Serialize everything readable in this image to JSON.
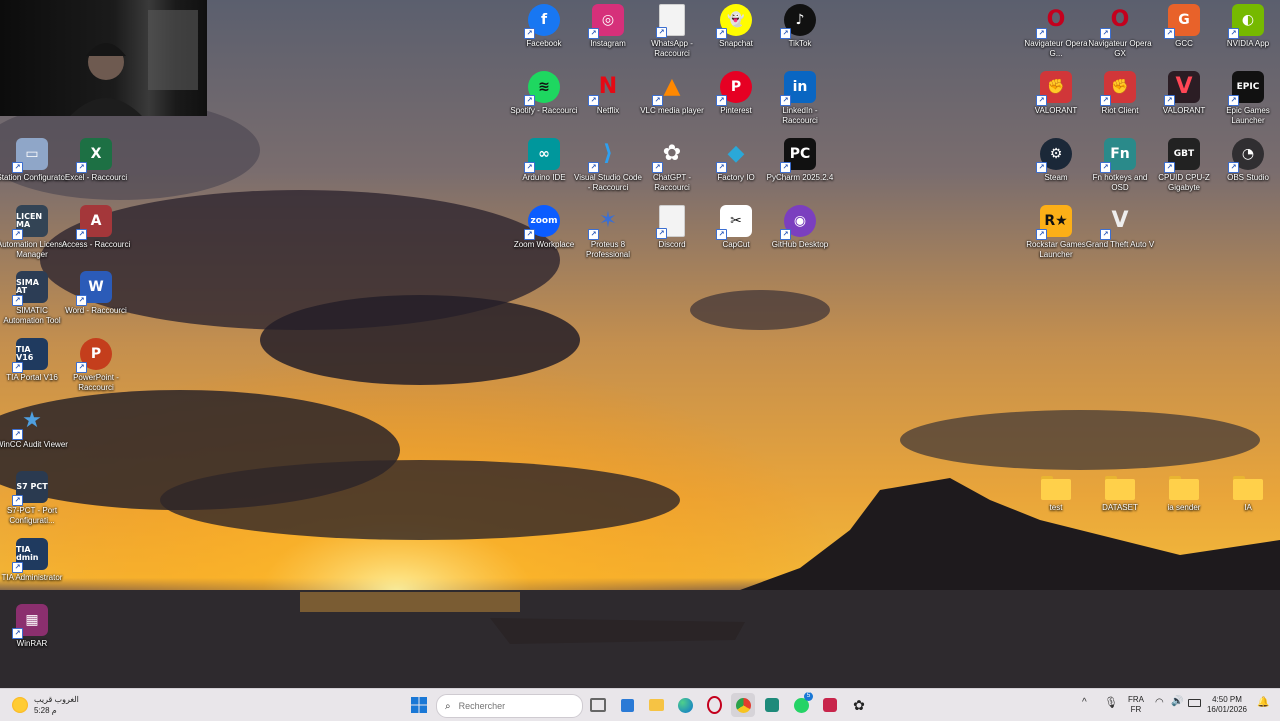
{
  "webcam": {
    "description_icon": "webcam-preview"
  },
  "desktop_icons": [
    {
      "id": "facebook",
      "label": "Facebook",
      "bg": "#1877f2",
      "glyph": "f",
      "round": true
    },
    {
      "id": "instagram",
      "label": "Instagram",
      "bg": "#d6307a",
      "glyph": "◎",
      "round": false
    },
    {
      "id": "whatsapp",
      "label": "WhatsApp - Raccourci",
      "bg": "#f3f3f3",
      "glyph": "",
      "round": false,
      "doc": true
    },
    {
      "id": "snapchat",
      "label": "Snapchat",
      "bg": "#fffc00",
      "glyph": "👻",
      "round": true,
      "dark": true
    },
    {
      "id": "tiktok",
      "label": "TikTok",
      "bg": "#111111",
      "glyph": "♪",
      "round": true
    },
    {
      "id": "spotify",
      "label": "Spotify - Raccourci",
      "bg": "#1ed760",
      "glyph": "≋",
      "round": true,
      "dark": true
    },
    {
      "id": "netflix",
      "label": "Netflix",
      "bg": "transparent",
      "glyph": "N",
      "round": false,
      "fg": "#e50914"
    },
    {
      "id": "vlc",
      "label": "VLC media player",
      "bg": "transparent",
      "glyph": "▲",
      "round": false,
      "fg": "#ff8800"
    },
    {
      "id": "pinterest",
      "label": "Pinterest",
      "bg": "#e60023",
      "glyph": "P",
      "round": true
    },
    {
      "id": "linkedin",
      "label": "LinkedIn - Raccourci",
      "bg": "#0a66c2",
      "glyph": "in",
      "round": false
    },
    {
      "id": "arduino",
      "label": "Arduino IDE",
      "bg": "#00979c",
      "glyph": "∞",
      "round": false
    },
    {
      "id": "vscode",
      "label": "Visual Studio Code - Raccourci",
      "bg": "transparent",
      "glyph": "⟩",
      "round": false,
      "fg": "#2ea0f0"
    },
    {
      "id": "chatgpt",
      "label": "ChatGPT - Raccourci",
      "bg": "transparent",
      "glyph": "✿",
      "round": false,
      "fg": "#ffffff"
    },
    {
      "id": "factoryio",
      "label": "Factory IO",
      "bg": "transparent",
      "glyph": "◆",
      "round": false,
      "fg": "#2aa8d8"
    },
    {
      "id": "pycharm",
      "label": "PyCharm 2025.2.4",
      "bg": "#111111",
      "glyph": "PC",
      "round": false
    },
    {
      "id": "zoom",
      "label": "Zoom Workplace",
      "bg": "#0b5cff",
      "glyph": "zoom",
      "round": true
    },
    {
      "id": "proteus",
      "label": "Proteus 8 Professional",
      "bg": "transparent",
      "glyph": "✶",
      "round": false,
      "fg": "#3b6fd3"
    },
    {
      "id": "discord",
      "label": "Discord",
      "bg": "#f3f3f3",
      "glyph": "",
      "round": false,
      "doc": true
    },
    {
      "id": "capcut",
      "label": "CapCut",
      "bg": "#ffffff",
      "glyph": "✂",
      "round": false,
      "dark": true
    },
    {
      "id": "github",
      "label": "GitHub Desktop",
      "bg": "#7b3fbf",
      "glyph": "◉",
      "round": true
    },
    {
      "id": "opera1",
      "label": "Navigateur Opera G...",
      "bg": "transparent",
      "glyph": "O",
      "round": true,
      "fg": "#c4001d"
    },
    {
      "id": "opera2",
      "label": "Navigateur Opera GX",
      "bg": "transparent",
      "glyph": "O",
      "round": true,
      "fg": "#c4001d"
    },
    {
      "id": "gcc",
      "label": "GCC",
      "bg": "#e8622a",
      "glyph": "G",
      "round": false
    },
    {
      "id": "nvidia",
      "label": "NVIDIA App",
      "bg": "#76b900",
      "glyph": "◐",
      "round": false
    },
    {
      "id": "valorant1",
      "label": "VALORANT",
      "bg": "#d13639",
      "glyph": "✊",
      "round": false
    },
    {
      "id": "riot",
      "label": "Riot Client",
      "bg": "#d13639",
      "glyph": "✊",
      "round": false
    },
    {
      "id": "valorant2",
      "label": "VALORANT",
      "bg": "#2b1d24",
      "glyph": "V",
      "round": false,
      "fg": "#ff4655"
    },
    {
      "id": "epic",
      "label": "Epic Games Launcher",
      "bg": "#111111",
      "glyph": "EPIC",
      "round": false
    },
    {
      "id": "steam",
      "label": "Steam",
      "bg": "#1b2838",
      "glyph": "⚙",
      "round": true
    },
    {
      "id": "fnhotkeys",
      "label": "Fn hotkeys and OSD",
      "bg": "#2a8a8a",
      "glyph": "Fn",
      "round": false
    },
    {
      "id": "cpuz",
      "label": "CPUID CPU-Z Gigabyte",
      "bg": "#222222",
      "glyph": "GBT",
      "round": false
    },
    {
      "id": "obs",
      "label": "OBS Studio",
      "bg": "#302e31",
      "glyph": "◔",
      "round": true
    },
    {
      "id": "rockstar",
      "label": "Rockstar Games Launcher",
      "bg": "#fcaf17",
      "glyph": "R★",
      "round": false,
      "dark": true
    },
    {
      "id": "gta",
      "label": "Grand Theft Auto V",
      "bg": "transparent",
      "glyph": "V",
      "round": false,
      "fg": "#eeeeee"
    },
    {
      "id": "station",
      "label": "Station Configurator",
      "bg": "#8fa6c8",
      "glyph": "▭",
      "round": false
    },
    {
      "id": "excel",
      "label": "Excel - Raccourci",
      "bg": "#1d7044",
      "glyph": "X",
      "round": false
    },
    {
      "id": "automation",
      "label": "Automation License Manager",
      "bg": "#334455",
      "glyph": "LICEN MA",
      "round": false
    },
    {
      "id": "access",
      "label": "Access - Raccourci",
      "bg": "#a4373a",
      "glyph": "A",
      "round": false
    },
    {
      "id": "simatic",
      "label": "SIMATIC Automation Tool",
      "bg": "#2c3d55",
      "glyph": "SIMA AT",
      "round": false
    },
    {
      "id": "word",
      "label": "Word - Raccourci",
      "bg": "#2b5bb8",
      "glyph": "W",
      "round": false
    },
    {
      "id": "tia16",
      "label": "TIA Portal V16",
      "bg": "#1f3a5f",
      "glyph": "TIA V16",
      "round": false
    },
    {
      "id": "powerpoint",
      "label": "PowerPoint - Raccourci",
      "bg": "#c43e1c",
      "glyph": "P",
      "round": true
    },
    {
      "id": "wincc",
      "label": "WinCC Audit Viewer",
      "bg": "transparent",
      "glyph": "★",
      "round": false,
      "fg": "#4fa0e0"
    },
    {
      "id": "s7pct",
      "label": "S7-PCT - Port Configurati...",
      "bg": "#2a3a50",
      "glyph": "S7 PCT",
      "round": false
    },
    {
      "id": "tiaadmin",
      "label": "TIA Administrator",
      "bg": "#1f3a5f",
      "glyph": "TIA dmin",
      "round": false
    },
    {
      "id": "winrar",
      "label": "WinRAR",
      "bg": "#8b2f6e",
      "glyph": "▦",
      "round": false
    },
    {
      "id": "test",
      "label": "test",
      "folder": true
    },
    {
      "id": "dataset",
      "label": "DATASET",
      "folder": true
    },
    {
      "id": "iasender",
      "label": "ia sender",
      "folder": true
    },
    {
      "id": "ia",
      "label": "IA",
      "folder": true
    }
  ],
  "taskbar": {
    "weather_line1": "الغروب قريب",
    "weather_line2": "5:28 م",
    "search_placeholder": "Rechercher",
    "lang_line1": "FRA",
    "lang_line2": "FR",
    "time": "4:50 PM",
    "date": "16/01/2026",
    "whatsapp_badge": "5"
  }
}
